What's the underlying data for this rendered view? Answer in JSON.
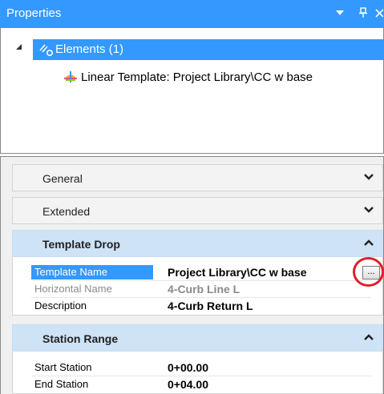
{
  "panel": {
    "title": "Properties",
    "dropdown_icon": "triangle-down",
    "pin_icon": "pin",
    "close_icon": "close"
  },
  "tree": {
    "root": {
      "label": "Elements (1)",
      "icon": "elements-icon",
      "expanded": true
    },
    "child": {
      "label": "Linear Template: Project Library\\CC w base",
      "icon": "linear-template-icon"
    }
  },
  "sections": {
    "general": {
      "label": "General",
      "state": "collapsed"
    },
    "extended": {
      "label": "Extended",
      "state": "collapsed"
    },
    "template_drop": {
      "label": "Template Drop",
      "state": "expanded",
      "rows": [
        {
          "name": "Template Name",
          "value": "Project Library\\CC w base",
          "selected": true
        },
        {
          "name": "Horizontal Name",
          "value": "4-Curb Line L",
          "disabled": true
        },
        {
          "name": "Description",
          "value": "4-Curb Return L"
        }
      ],
      "browse_button": "..."
    },
    "station_range": {
      "label": "Station Range",
      "state": "expanded",
      "rows": [
        {
          "name": "Start Station",
          "value": "0+00.00"
        },
        {
          "name": "End Station",
          "value": "0+04.00"
        }
      ]
    }
  },
  "colors": {
    "accent": "#3399ff",
    "section_header": "#cfe3f7",
    "annotation_circle": "#e0202a"
  }
}
